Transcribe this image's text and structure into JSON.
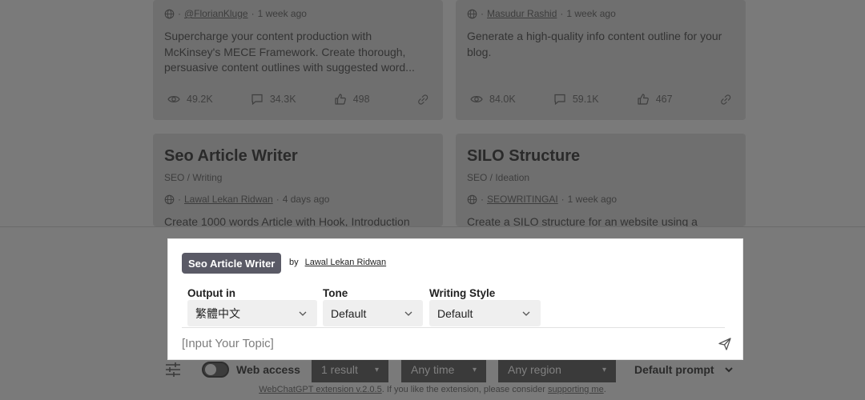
{
  "cards": [
    {
      "author": "@FlorianKluge",
      "time": "1 week ago",
      "description": "Supercharge your content production with McKinsey's MECE Framework. Create thorough, persuasive content outlines with suggested word...",
      "views": "49.2K",
      "comments": "34.3K",
      "likes": "498"
    },
    {
      "author": "Masudur Rashid",
      "time": "1 week ago",
      "description": "Generate a high-quality info content outline for your blog.",
      "views": "84.0K",
      "comments": "59.1K",
      "likes": "467"
    },
    {
      "title": "Seo Article Writer",
      "category": "SEO / Writing",
      "author": "Lawal Lekan Ridwan",
      "time": "4 days ago",
      "description": "Create 1000 words Article with Hook, Introduction"
    },
    {
      "title": "SILO Structure",
      "category": "SEO / Ideation",
      "author": "SEOWRITINGAI",
      "time": "1 week ago",
      "description": "Create a SILO structure for an website using a"
    }
  ],
  "meta_separator": "·",
  "panel": {
    "prompt_name": "Seo Article Writer",
    "by_label": "by",
    "author": "Lawal Lekan Ridwan",
    "output_label": "Output in",
    "output_value": "繁體中文",
    "tone_label": "Tone",
    "tone_value": "Default",
    "style_label": "Writing Style",
    "style_value": "Default",
    "input_placeholder": "[Input Your Topic]",
    "input_value": ""
  },
  "toolbar": {
    "web_access_label": "Web access",
    "results": "1 result",
    "time": "Any time",
    "region": "Any region",
    "default_prompt": "Default prompt"
  },
  "footer": {
    "extension_link": "WebChatGPT extension v.2.0.5",
    "middle_text": ". If you like the extension, please consider ",
    "support_link": "supporting me",
    "end_text": "."
  },
  "icons": {
    "globe": "globe-icon",
    "views": "eye-icon",
    "comments": "comment-icon",
    "likes": "thumbs-up-icon",
    "link": "link-icon",
    "settings": "sliders-icon",
    "send": "send-icon",
    "dropdown": "chevron-down-icon"
  },
  "colors": {
    "chip_bg": "#5a5a66",
    "overlay": "#7a7a7a",
    "panel_bg": "#ffffff",
    "select_bg": "#efefef"
  }
}
